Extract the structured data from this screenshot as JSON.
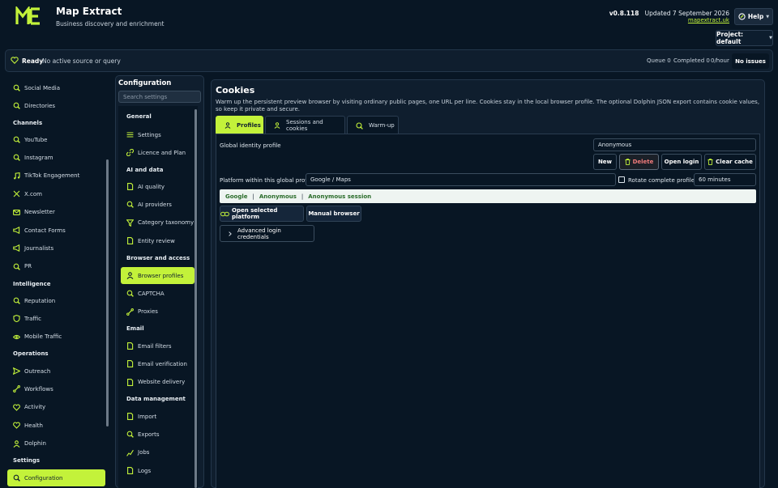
{
  "header": {
    "logo_text": "ME",
    "title": "Map Extract",
    "subtitle": "Business discovery and enrichment",
    "version": "v0.8.118",
    "updated": "Updated 7 September 2026",
    "site": "mapextract.uk",
    "help_label": "Help",
    "project_label": "Project: default"
  },
  "status": {
    "state": "Ready",
    "message": "No active source or query",
    "queue": "Queue 0",
    "completed": "Completed 0",
    "rate": "0/hour",
    "issues": "No issues"
  },
  "sidebar": {
    "items": [
      {
        "label": "Social Media",
        "icon": "tag-icon"
      },
      {
        "label": "Directories",
        "icon": "tag-icon"
      }
    ],
    "channels_head": "Channels",
    "channels": [
      {
        "label": "YouTube",
        "icon": "tag-icon"
      },
      {
        "label": "Instagram",
        "icon": "tag-icon"
      },
      {
        "label": "TikTok Engagement",
        "icon": "music-icon"
      },
      {
        "label": "X.com",
        "icon": "x-icon"
      },
      {
        "label": "Newsletter",
        "icon": "mail-icon"
      },
      {
        "label": "Contact Forms",
        "icon": "megaphone-icon"
      },
      {
        "label": "Journalists",
        "icon": "megaphone-icon"
      },
      {
        "label": "PR",
        "icon": "tag-icon"
      }
    ],
    "intelligence_head": "Intelligence",
    "intelligence": [
      {
        "label": "Reputation",
        "icon": "tag-icon"
      },
      {
        "label": "Traffic",
        "icon": "shield-icon"
      },
      {
        "label": "Mobile Traffic",
        "icon": "eye-icon"
      }
    ],
    "operations_head": "Operations",
    "operations": [
      {
        "label": "Outreach",
        "icon": "send-icon"
      },
      {
        "label": "Workflows",
        "icon": "flow-icon"
      },
      {
        "label": "Activity",
        "icon": "heart-icon"
      },
      {
        "label": "Health",
        "icon": "heart-icon"
      },
      {
        "label": "Dolphin",
        "icon": "person-icon"
      }
    ],
    "settings_head": "Settings",
    "settings": [
      {
        "label": "Configuration",
        "icon": "tag-icon"
      }
    ]
  },
  "config": {
    "title": "Configuration",
    "search_placeholder": "Search settings",
    "general_head": "General",
    "general": [
      {
        "label": "Settings",
        "icon": "sliders-icon"
      },
      {
        "label": "Licence and Plan",
        "icon": "link-icon"
      }
    ],
    "ai_head": "AI and data",
    "ai": [
      {
        "label": "AI quality",
        "icon": "doc-icon"
      },
      {
        "label": "AI providers",
        "icon": "tag-icon"
      },
      {
        "label": "Category taxonomy",
        "icon": "filter-icon"
      },
      {
        "label": "Entity review",
        "icon": "doc-icon"
      }
    ],
    "browser_head": "Browser and access",
    "browser": [
      {
        "label": "Browser profiles",
        "icon": "person-icon"
      },
      {
        "label": "CAPTCHA",
        "icon": "tag-icon"
      },
      {
        "label": "Proxies",
        "icon": "flow-icon"
      }
    ],
    "email_head": "Email",
    "email": [
      {
        "label": "Email filters",
        "icon": "doc-icon"
      },
      {
        "label": "Email verification",
        "icon": "doc-icon"
      },
      {
        "label": "Website delivery",
        "icon": "doc-icon"
      }
    ],
    "data_head": "Data management",
    "data": [
      {
        "label": "Import",
        "icon": "doc-icon"
      },
      {
        "label": "Exports",
        "icon": "tag-icon"
      },
      {
        "label": "Jobs",
        "icon": "chart-icon"
      },
      {
        "label": "Logs",
        "icon": "doc-icon"
      }
    ]
  },
  "main": {
    "title": "Cookies",
    "description": "Warm up the persistent preview browser by visiting ordinary public pages, one URL per line. Cookies stay in the local browser profile. The optional Dolphin JSON export contains cookie values, so keep it private and secure.",
    "tabs": [
      {
        "label": "Profiles",
        "icon": "person-icon"
      },
      {
        "label": "Sessions and cookies",
        "icon": "person-icon"
      },
      {
        "label": "Warm-up",
        "icon": "tag-icon"
      }
    ],
    "identity_label": "Global identity profile",
    "identity_value": "Anonymous",
    "btn_new": "New",
    "btn_delete": "Delete",
    "btn_open_login": "Open login",
    "btn_clear_cache": "Clear cache",
    "platform_label": "Platform within this global profile",
    "platform_value": "Google / Maps",
    "rotate_label": "Rotate complete profiles",
    "rotate_value": "60 minutes",
    "crumb": [
      "Google",
      "Anonymous",
      "Anonymous session"
    ],
    "crumb_sep": "|",
    "btn_open_platform": "Open selected platform",
    "btn_manual": "Manual browser",
    "advanced": "Advanced login credentials"
  },
  "colors": {
    "accent": "#c3f23a",
    "background": "#081624",
    "panel": "#0f1e2e",
    "danger": "#f07b7b"
  }
}
